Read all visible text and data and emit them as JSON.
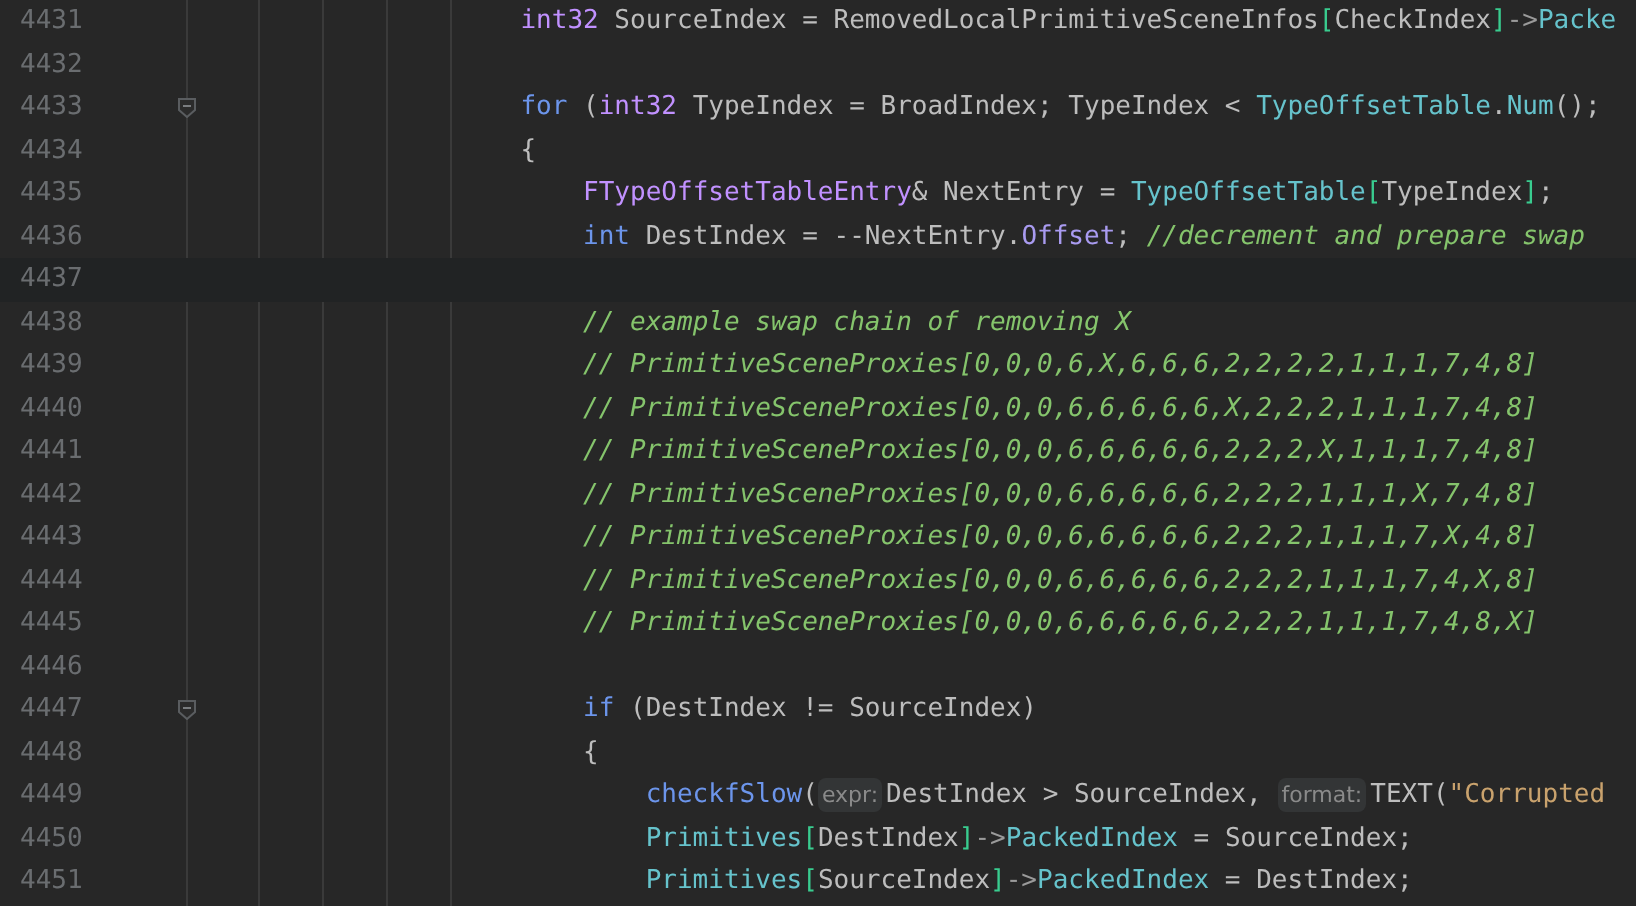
{
  "editor": {
    "lines": [
      {
        "number": "4431",
        "current": false,
        "fold": false,
        "tokens": [
          {
            "kind": "type",
            "text": "int32"
          },
          {
            "kind": "plain",
            "text": " SourceIndex = RemovedLocalPrimitiveSceneInfos"
          },
          {
            "kind": "bracket",
            "text": "["
          },
          {
            "kind": "plain",
            "text": "CheckIndex"
          },
          {
            "kind": "bracket",
            "text": "]"
          },
          {
            "kind": "operator",
            "text": "->"
          },
          {
            "kind": "member",
            "text": "Packe"
          }
        ]
      },
      {
        "number": "4432",
        "current": false,
        "fold": false
      },
      {
        "number": "4433",
        "current": false,
        "fold": true,
        "tokens": [
          {
            "kind": "keyword",
            "text": "for"
          },
          {
            "kind": "plain",
            "text": " ("
          },
          {
            "kind": "type",
            "text": "int32"
          },
          {
            "kind": "plain",
            "text": " TypeIndex = BroadIndex; TypeIndex < "
          },
          {
            "kind": "member",
            "text": "TypeOffsetTable"
          },
          {
            "kind": "plain",
            "text": "."
          },
          {
            "kind": "member",
            "text": "Num"
          },
          {
            "kind": "plain",
            "text": "();"
          }
        ]
      },
      {
        "number": "4434",
        "current": false,
        "fold": false,
        "tokens": [
          {
            "kind": "plain",
            "text": "{"
          }
        ],
        "children": [
          {
            "number": "4435",
            "current": false,
            "fold": false,
            "tokens": [
              {
                "kind": "type",
                "text": "FTypeOffsetTableEntry"
              },
              {
                "kind": "plain",
                "text": "& NextEntry = "
              },
              {
                "kind": "member",
                "text": "TypeOffsetTable"
              },
              {
                "kind": "bracket",
                "text": "["
              },
              {
                "kind": "plain",
                "text": "TypeIndex"
              },
              {
                "kind": "bracket",
                "text": "]"
              },
              {
                "kind": "plain",
                "text": ";"
              }
            ]
          },
          {
            "number": "4436",
            "current": false,
            "fold": false,
            "tokens": [
              {
                "kind": "keyword",
                "text": "int"
              },
              {
                "kind": "plain",
                "text": " DestIndex = --NextEntry."
              },
              {
                "kind": "field",
                "text": "Offset"
              },
              {
                "kind": "plain",
                "text": "; "
              },
              {
                "kind": "comment",
                "text": "//decrement and prepare swap"
              }
            ]
          },
          {
            "number": "4437",
            "current": true,
            "fold": false
          },
          {
            "number": "4438",
            "current": false,
            "fold": false,
            "tokens": [
              {
                "kind": "comment",
                "text": "// example swap chain of removing X"
              }
            ]
          },
          {
            "number": "4439",
            "current": false,
            "fold": false,
            "tokens": [
              {
                "kind": "comment",
                "text": "// PrimitiveSceneProxies[0,0,0,6,X,6,6,6,2,2,2,2,1,1,1,7,4,8]"
              }
            ]
          },
          {
            "number": "4440",
            "current": false,
            "fold": false,
            "tokens": [
              {
                "kind": "comment",
                "text": "// PrimitiveSceneProxies[0,0,0,6,6,6,6,6,X,2,2,2,1,1,1,7,4,8]"
              }
            ]
          },
          {
            "number": "4441",
            "current": false,
            "fold": false,
            "tokens": [
              {
                "kind": "comment",
                "text": "// PrimitiveSceneProxies[0,0,0,6,6,6,6,6,2,2,2,X,1,1,1,7,4,8]"
              }
            ]
          },
          {
            "number": "4442",
            "current": false,
            "fold": false,
            "tokens": [
              {
                "kind": "comment",
                "text": "// PrimitiveSceneProxies[0,0,0,6,6,6,6,6,2,2,2,1,1,1,X,7,4,8]"
              }
            ]
          },
          {
            "number": "4443",
            "current": false,
            "fold": false,
            "tokens": [
              {
                "kind": "comment",
                "text": "// PrimitiveSceneProxies[0,0,0,6,6,6,6,6,2,2,2,1,1,1,7,X,4,8]"
              }
            ]
          },
          {
            "number": "4444",
            "current": false,
            "fold": false,
            "tokens": [
              {
                "kind": "comment",
                "text": "// PrimitiveSceneProxies[0,0,0,6,6,6,6,6,2,2,2,1,1,1,7,4,X,8]"
              }
            ]
          },
          {
            "number": "4445",
            "current": false,
            "fold": false,
            "tokens": [
              {
                "kind": "comment",
                "text": "// PrimitiveSceneProxies[0,0,0,6,6,6,6,6,2,2,2,1,1,1,7,4,8,X]"
              }
            ]
          },
          {
            "number": "4446",
            "current": false,
            "fold": false
          },
          {
            "number": "4447",
            "current": false,
            "fold": true,
            "tokens": [
              {
                "kind": "keyword",
                "text": "if"
              },
              {
                "kind": "plain",
                "text": " (DestIndex != SourceIndex)"
              }
            ]
          },
          {
            "number": "4448",
            "current": false,
            "fold": false,
            "tokens": [
              {
                "kind": "plain",
                "text": "{"
              }
            ],
            "children": [
              {
                "number": "4449",
                "current": false,
                "fold": false,
                "tokens": [
                  {
                    "kind": "macro",
                    "text": "checkfSlow"
                  },
                  {
                    "kind": "plain",
                    "text": "("
                  },
                  {
                    "kind": "hint",
                    "text": "expr:"
                  },
                  {
                    "kind": "plain",
                    "text": "DestIndex > SourceIndex, "
                  },
                  {
                    "kind": "hint",
                    "text": "format:"
                  },
                  {
                    "kind": "plain",
                    "text": "TEXT("
                  },
                  {
                    "kind": "string",
                    "text": "\"Corrupted"
                  }
                ]
              },
              {
                "number": "4450",
                "current": false,
                "fold": false,
                "tokens": [
                  {
                    "kind": "member",
                    "text": "Primitives"
                  },
                  {
                    "kind": "bracket",
                    "text": "["
                  },
                  {
                    "kind": "plain",
                    "text": "DestIndex"
                  },
                  {
                    "kind": "bracket",
                    "text": "]"
                  },
                  {
                    "kind": "operator",
                    "text": "->"
                  },
                  {
                    "kind": "member",
                    "text": "PackedIndex"
                  },
                  {
                    "kind": "plain",
                    "text": " = SourceIndex;"
                  }
                ]
              },
              {
                "number": "4451",
                "current": false,
                "fold": false,
                "tokens": [
                  {
                    "kind": "member",
                    "text": "Primitives"
                  },
                  {
                    "kind": "bracket",
                    "text": "["
                  },
                  {
                    "kind": "plain",
                    "text": "SourceIndex"
                  },
                  {
                    "kind": "bracket",
                    "text": "]"
                  },
                  {
                    "kind": "operator",
                    "text": "->"
                  },
                  {
                    "kind": "member",
                    "text": "PackedIndex"
                  },
                  {
                    "kind": "plain",
                    "text": " = DestIndex;"
                  }
                ]
              }
            ]
          }
        ]
      }
    ]
  }
}
